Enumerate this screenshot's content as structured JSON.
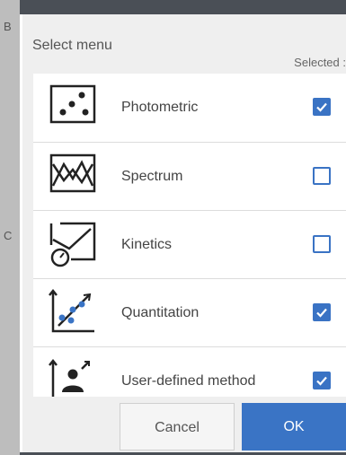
{
  "dialog": {
    "title": "Select menu",
    "selected_header": "Selected :",
    "items": [
      {
        "label": "Photometric",
        "icon": "photometric-icon",
        "selected": true
      },
      {
        "label": "Spectrum",
        "icon": "spectrum-icon",
        "selected": false
      },
      {
        "label": "Kinetics",
        "icon": "kinetics-icon",
        "selected": false
      },
      {
        "label": "Quantitation",
        "icon": "quantitation-icon",
        "selected": true
      },
      {
        "label": "User-defined method",
        "icon": "user-defined-method-icon",
        "selected": true
      }
    ],
    "cancel_label": "Cancel",
    "ok_label": "OK"
  },
  "background": {
    "fragments": [
      "B",
      "C"
    ]
  },
  "colors": {
    "accent": "#3a74c5",
    "dialog_bg": "#efefef",
    "dim_strip": "#bdbdbd",
    "top_bar": "#4a4f56"
  }
}
